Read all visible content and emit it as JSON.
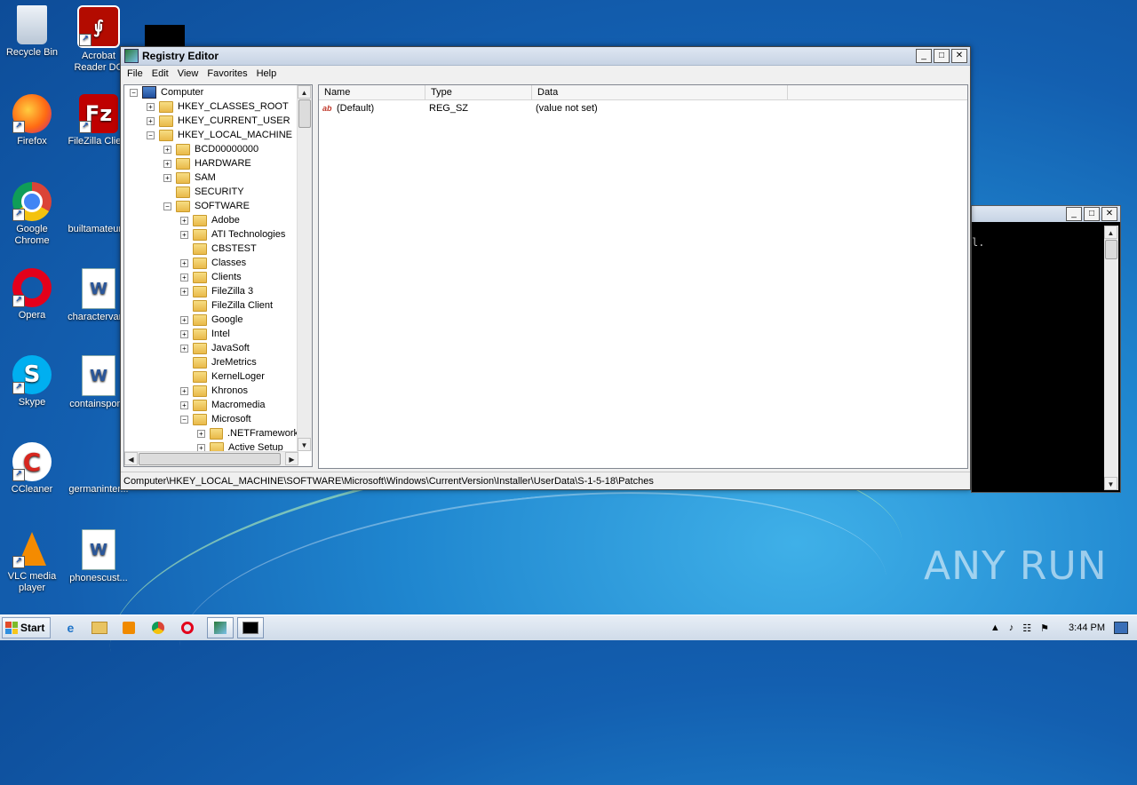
{
  "desktop": {
    "icons": [
      {
        "label": "Recycle Bin",
        "icon": "recycle-bin-icon"
      },
      {
        "label": "Acrobat Reader DC",
        "icon": "acrobat-icon"
      },
      {
        "label": "Firefox",
        "icon": "firefox-icon"
      },
      {
        "label": "FileZilla Client",
        "icon": "filezilla-icon"
      },
      {
        "label": "Google Chrome",
        "icon": "chrome-icon"
      },
      {
        "label": "builtamateur...",
        "icon": "blank-file-icon"
      },
      {
        "label": "Opera",
        "icon": "opera-icon"
      },
      {
        "label": "charactervar...",
        "icon": "word-doc-icon"
      },
      {
        "label": "Skype",
        "icon": "skype-icon"
      },
      {
        "label": "containspor...",
        "icon": "word-doc-icon"
      },
      {
        "label": "CCleaner",
        "icon": "ccleaner-icon"
      },
      {
        "label": "germaninter...",
        "icon": "blank-file-icon"
      },
      {
        "label": "VLC media player",
        "icon": "vlc-icon"
      },
      {
        "label": "phonescust...",
        "icon": "word-doc-icon"
      }
    ],
    "watermark": "ANY RUN"
  },
  "regedit": {
    "title": "Registry Editor",
    "menu": [
      "File",
      "Edit",
      "View",
      "Favorites",
      "Help"
    ],
    "tree": [
      {
        "label": "Computer",
        "depth": 0,
        "state": "expanded",
        "icon": "computer-icon"
      },
      {
        "label": "HKEY_CLASSES_ROOT",
        "depth": 1,
        "state": "collapsed"
      },
      {
        "label": "HKEY_CURRENT_USER",
        "depth": 1,
        "state": "collapsed"
      },
      {
        "label": "HKEY_LOCAL_MACHINE",
        "depth": 1,
        "state": "expanded"
      },
      {
        "label": "BCD00000000",
        "depth": 2,
        "state": "collapsed"
      },
      {
        "label": "HARDWARE",
        "depth": 2,
        "state": "collapsed"
      },
      {
        "label": "SAM",
        "depth": 2,
        "state": "collapsed"
      },
      {
        "label": "SECURITY",
        "depth": 2,
        "state": "leaf"
      },
      {
        "label": "SOFTWARE",
        "depth": 2,
        "state": "expanded"
      },
      {
        "label": "Adobe",
        "depth": 3,
        "state": "collapsed"
      },
      {
        "label": "ATI Technologies",
        "depth": 3,
        "state": "collapsed"
      },
      {
        "label": "CBSTEST",
        "depth": 3,
        "state": "leaf"
      },
      {
        "label": "Classes",
        "depth": 3,
        "state": "collapsed"
      },
      {
        "label": "Clients",
        "depth": 3,
        "state": "collapsed"
      },
      {
        "label": "FileZilla 3",
        "depth": 3,
        "state": "collapsed"
      },
      {
        "label": "FileZilla Client",
        "depth": 3,
        "state": "leaf"
      },
      {
        "label": "Google",
        "depth": 3,
        "state": "collapsed"
      },
      {
        "label": "Intel",
        "depth": 3,
        "state": "collapsed"
      },
      {
        "label": "JavaSoft",
        "depth": 3,
        "state": "collapsed"
      },
      {
        "label": "JreMetrics",
        "depth": 3,
        "state": "leaf"
      },
      {
        "label": "KernelLoger",
        "depth": 3,
        "state": "leaf"
      },
      {
        "label": "Khronos",
        "depth": 3,
        "state": "collapsed"
      },
      {
        "label": "Macromedia",
        "depth": 3,
        "state": "collapsed"
      },
      {
        "label": "Microsoft",
        "depth": 3,
        "state": "expanded"
      },
      {
        "label": ".NETFramework",
        "depth": 4,
        "state": "collapsed"
      },
      {
        "label": "Active Setup",
        "depth": 4,
        "state": "collapsed"
      }
    ],
    "columns": [
      "Name",
      "Type",
      "Data"
    ],
    "values": [
      {
        "name": "(Default)",
        "type": "REG_SZ",
        "data": "(value not set)"
      }
    ],
    "status_path": "Computer\\HKEY_LOCAL_MACHINE\\SOFTWARE\\Microsoft\\Windows\\CurrentVersion\\Installer\\UserData\\S-1-5-18\\Patches"
  },
  "console": {
    "text": "l."
  },
  "taskbar": {
    "start_label": "Start",
    "clock": "3:44 PM",
    "pinned": [
      "ie-icon",
      "explorer-icon",
      "media-player-icon",
      "chrome-icon",
      "opera-icon",
      "regedit-icon",
      "cmd-icon"
    ]
  }
}
